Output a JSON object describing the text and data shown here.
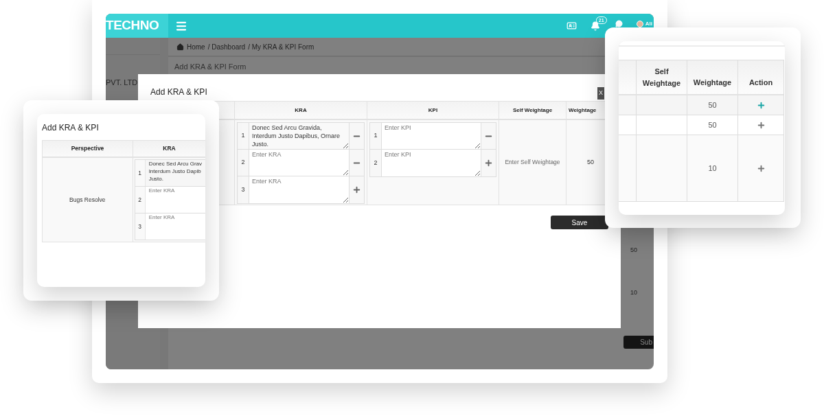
{
  "app": {
    "logo": "TECHNO",
    "notification_count": "21",
    "user_name": "Ali",
    "company": "PVT. LTD",
    "breadcrumb": [
      {
        "label": "Home"
      },
      {
        "label": "/ Dashboard"
      },
      {
        "label": "/ My KRA & KPI Form"
      }
    ],
    "page_title": "Add KRA & KPI Form",
    "background_values": [
      "50",
      "10"
    ],
    "submit_button": "Sub"
  },
  "modal": {
    "title": "Add KRA & KPI",
    "close": "X",
    "columns": [
      "KRA",
      "KPI",
      "Self Weightage",
      "Weightage"
    ],
    "kra_items": [
      {
        "number": "1",
        "value": "Donec Sed Arcu Gravida, Interdum Justo Dapibus, Ornare Justo.",
        "kind": "minus"
      },
      {
        "number": "2",
        "placeholder": "Enter KRA",
        "kind": "minus"
      },
      {
        "number": "3",
        "placeholder": "Enter KRA",
        "kind": "plus"
      }
    ],
    "kpi_items": [
      {
        "number": "1",
        "placeholder": "Enter KPI",
        "kind": "minus"
      },
      {
        "number": "2",
        "placeholder": "Enter KPI",
        "kind": "plus"
      }
    ],
    "self_weightage_placeholder": "Enter Self Weightage",
    "weightage": "50",
    "save_button": "Save"
  },
  "left_card": {
    "title": "Add KRA & KPI",
    "columns": [
      "Perspective",
      "KRA"
    ],
    "perspective": "Bugs Resolve",
    "kra_items": [
      {
        "number": "1",
        "lines": [
          "Donec Sed Arcu Grav",
          "Interdum Justo Dapib",
          "Justo."
        ]
      },
      {
        "number": "2",
        "lines": [
          "Enter KRA"
        ]
      },
      {
        "number": "3",
        "lines": [
          "Enter KRA"
        ]
      }
    ]
  },
  "right_card": {
    "columns": [
      "Self Weightage",
      "Weightage",
      "Action"
    ],
    "rows": [
      {
        "weightage": "50",
        "highlighted": true
      },
      {
        "weightage": "50",
        "highlighted": false
      },
      {
        "weightage": "10",
        "highlighted": false
      }
    ]
  }
}
